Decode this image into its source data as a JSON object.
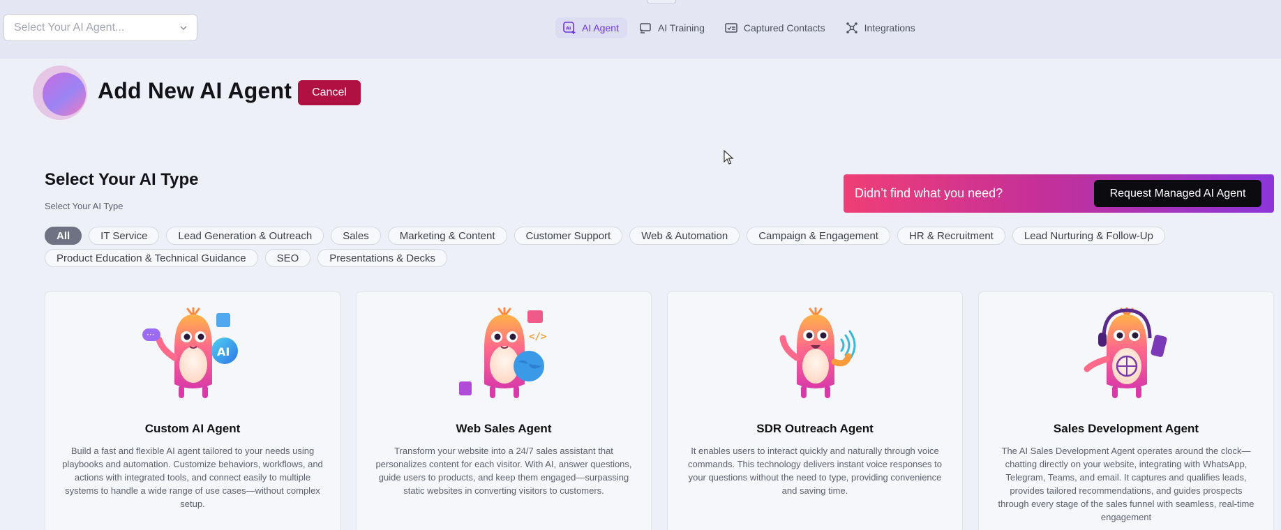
{
  "top_bar": {
    "agent_select_placeholder": "Select Your AI Agent...",
    "nav": [
      {
        "label": "AI Agent",
        "icon": "ai-agent-icon",
        "active": true
      },
      {
        "label": "AI Training",
        "icon": "ai-training-icon",
        "active": false
      },
      {
        "label": "Captured Contacts",
        "icon": "contacts-card-icon",
        "active": false
      },
      {
        "label": "Integrations",
        "icon": "integrations-icon",
        "active": false
      }
    ]
  },
  "header": {
    "title": "Add New AI Agent",
    "cancel_label": "Cancel"
  },
  "section": {
    "title": "Select Your AI Type",
    "subtitle": "Select Your AI Type"
  },
  "promo": {
    "text": "Didn’t find what you need?",
    "button_label": "Request Managed AI Agent"
  },
  "filters": [
    {
      "label": "All",
      "active": true
    },
    {
      "label": "IT Service",
      "active": false
    },
    {
      "label": "Lead Generation & Outreach",
      "active": false
    },
    {
      "label": "Sales",
      "active": false
    },
    {
      "label": "Marketing & Content",
      "active": false
    },
    {
      "label": "Customer Support",
      "active": false
    },
    {
      "label": "Web & Automation",
      "active": false
    },
    {
      "label": "Campaign & Engagement",
      "active": false
    },
    {
      "label": "HR & Recruitment",
      "active": false
    },
    {
      "label": "Lead Nurturing & Follow-Up",
      "active": false
    },
    {
      "label": "Product Education & Technical Guidance",
      "active": false
    },
    {
      "label": "SEO",
      "active": false
    },
    {
      "label": "Presentations & Decks",
      "active": false
    }
  ],
  "cards": [
    {
      "title": "Custom AI Agent",
      "description": "Build a fast and flexible AI agent tailored to your needs using playbooks and automation. Customize behaviors, workflows, and actions with integrated tools, and connect easily to multiple systems to handle a wide range of use cases—without complex setup.",
      "art_badge": "AI"
    },
    {
      "title": "Web Sales Agent",
      "description": "Transform your website into a 24/7 sales assistant that personalizes content for each visitor. With AI, answer questions, guide users to products, and keep them engaged—surpassing static websites in converting visitors to customers.",
      "art_badge": "</>"
    },
    {
      "title": "SDR Outreach Agent",
      "description": "It enables users to interact quickly and naturally through voice commands. This technology delivers instant voice responses to your questions without the need to type, providing convenience and saving time."
    },
    {
      "title": "Sales Development Agent",
      "description": "The AI Sales Development Agent operates around the clock—chatting directly on your website, integrating with WhatsApp, Telegram, Teams, and email. It captures and qualifies leads, provides tailored recommendations, and guides prospects through every stage of the sales funnel with seamless, real-time engagement"
    }
  ],
  "colors": {
    "accent_purple": "#6b33e6",
    "cancel_red": "#b01042",
    "promo_start": "#f03e76",
    "promo_end": "#8b36d9"
  }
}
